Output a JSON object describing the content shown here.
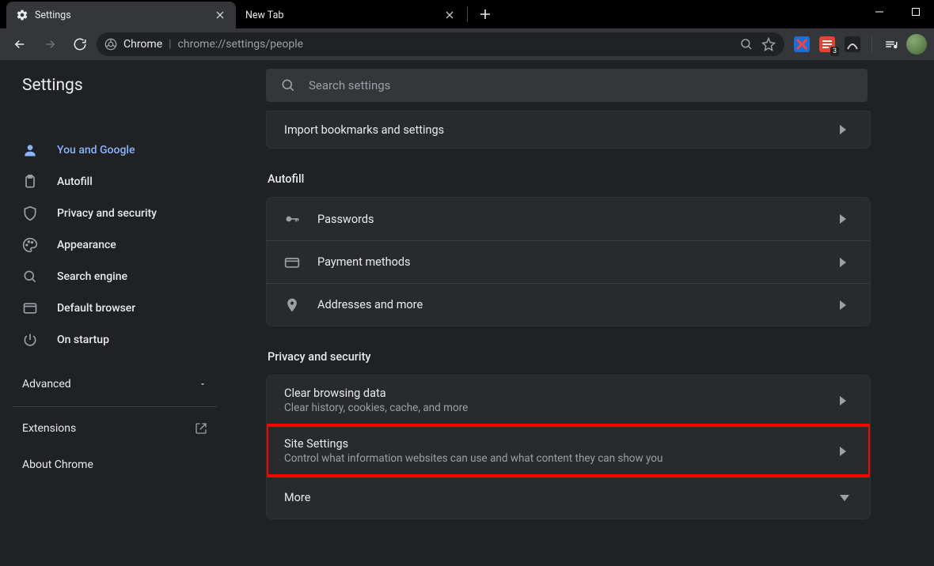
{
  "window": {
    "minimize_icon": "minimize",
    "maximize_icon": "maximize",
    "close_icon": "close"
  },
  "tabs": [
    {
      "title": "Settings",
      "active": true,
      "favicon": "gear",
      "closeable": true
    },
    {
      "title": "New Tab",
      "active": false,
      "favicon": "",
      "closeable": true
    }
  ],
  "toolbar": {
    "back_icon": "arrow-left",
    "forward_icon": "arrow-right",
    "reload_icon": "reload",
    "site_chip_icon": "chrome-logo",
    "site_chip_label": "Chrome",
    "url": "chrome://settings/people",
    "zoom_icon": "magnify",
    "star_icon": "star",
    "extensions": [
      {
        "name": "extension-1",
        "color": "#1a6fd6",
        "accent": "#e33",
        "badge": ""
      },
      {
        "name": "extension-2",
        "color": "#e44332",
        "accent": "#fff",
        "badge": "3"
      },
      {
        "name": "extension-3",
        "color": "#202124",
        "accent": "#ccc",
        "badge": ""
      }
    ],
    "media_icon": "music-note"
  },
  "settings": {
    "header_title": "Settings",
    "search_placeholder": "Search settings"
  },
  "sidebar": {
    "items": [
      {
        "label": "You and Google",
        "icon": "person",
        "active": true
      },
      {
        "label": "Autofill",
        "icon": "clipboard",
        "active": false
      },
      {
        "label": "Privacy and security",
        "icon": "shield",
        "active": false
      },
      {
        "label": "Appearance",
        "icon": "palette",
        "active": false
      },
      {
        "label": "Search engine",
        "icon": "search",
        "active": false
      },
      {
        "label": "Default browser",
        "icon": "window",
        "active": false
      },
      {
        "label": "On startup",
        "icon": "power",
        "active": false
      }
    ],
    "advanced_label": "Advanced",
    "extensions_label": "Extensions",
    "about_label": "About Chrome"
  },
  "main": {
    "top_truncated_row": {
      "label": "Import bookmarks and settings"
    },
    "sections": [
      {
        "title": "Autofill",
        "rows": [
          {
            "icon": "key",
            "label": "Passwords",
            "chevron": "right"
          },
          {
            "icon": "card",
            "label": "Payment methods",
            "chevron": "right"
          },
          {
            "icon": "location",
            "label": "Addresses and more",
            "chevron": "right"
          }
        ]
      },
      {
        "title": "Privacy and security",
        "rows": [
          {
            "label": "Clear browsing data",
            "sub": "Clear history, cookies, cache, and more",
            "chevron": "right"
          },
          {
            "label": "Site Settings",
            "sub": "Control what information websites can use and what content they can show you",
            "chevron": "right",
            "highlight": true
          },
          {
            "label": "More",
            "chevron": "down"
          }
        ]
      }
    ]
  }
}
